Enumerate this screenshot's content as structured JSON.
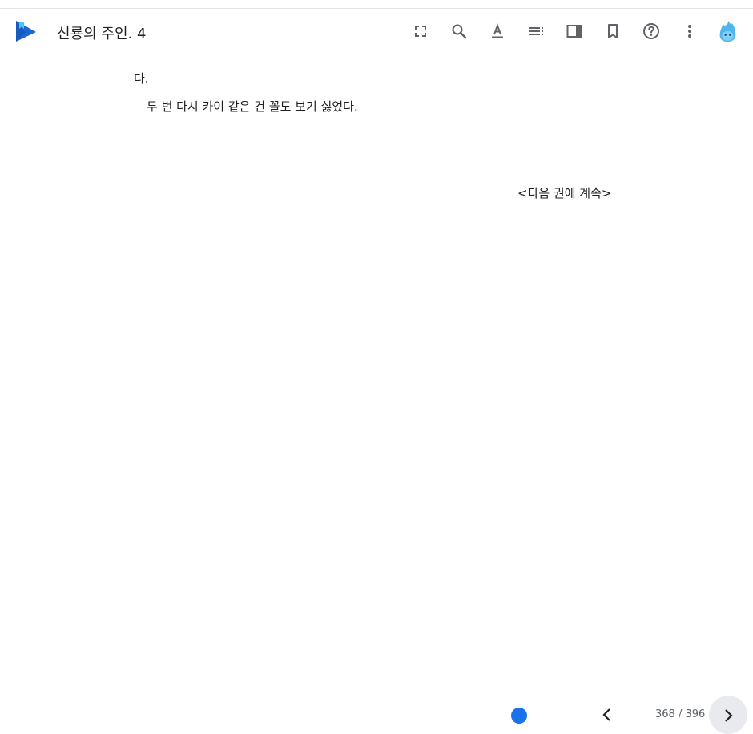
{
  "app": {
    "logo_icon": "play-books-icon"
  },
  "header": {
    "book_title": "신룡의 주인. 4",
    "toolbar": [
      {
        "name": "fullscreen-button",
        "icon": "fullscreen-icon"
      },
      {
        "name": "search-button",
        "icon": "search-icon"
      },
      {
        "name": "display-options-button",
        "icon": "text-format-icon"
      },
      {
        "name": "contents-button",
        "icon": "toc-icon"
      },
      {
        "name": "notes-panel-button",
        "icon": "side-panel-icon"
      },
      {
        "name": "bookmark-button",
        "icon": "bookmark-icon"
      },
      {
        "name": "help-button",
        "icon": "help-icon"
      },
      {
        "name": "more-options-button",
        "icon": "more-vert-icon"
      }
    ],
    "avatar_icon": "flame-avatar-icon"
  },
  "page": {
    "lines": [
      "다.",
      "두 번 다시 카이 같은 건 꼴도 보기 싫었다.",
      "<다음 권에 계속>"
    ]
  },
  "footer": {
    "page_indicator": "368 / 396",
    "progress": 0.93,
    "prev_icon": "chevron-left-icon",
    "next_icon": "chevron-right-icon"
  },
  "colors": {
    "accent": "#1a73e8",
    "icon": "#5f6368",
    "text": "#202124"
  }
}
